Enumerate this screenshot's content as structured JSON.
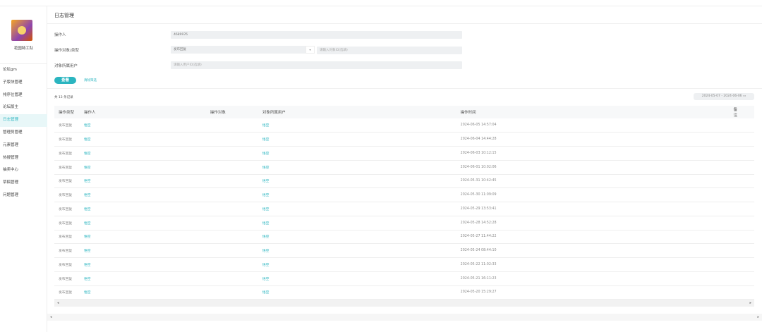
{
  "sidebar": {
    "team": "花园特工队",
    "items": [
      "论坛gm",
      "子版块管理",
      "排序位管理",
      "论坛版主",
      "日志管理",
      "管理员管理",
      "元素管理",
      "热搜管理",
      "抽奖中心",
      "草稿管理",
      "问题管理"
    ],
    "active": 4
  },
  "header": {
    "title": "日志管理"
  },
  "form": {
    "operator_label": "操作人",
    "operator_value": "4689976",
    "object_label": "操作对象/类型",
    "object_type": "发布回复",
    "object_placeholder": "请输入对象ID(选填)",
    "owner_label": "对象所属用户",
    "owner_placeholder": "请输入用户ID(选填)",
    "search_label": "查看",
    "reset_label": "清除筛选"
  },
  "count": "共 13 条记录",
  "date_range": {
    "start": "2024-05-07",
    "sep": "-",
    "end": "2024-06-06"
  },
  "table": {
    "columns": [
      "操作类型",
      "操作人",
      "操作对象",
      "对象所属用户",
      "操作时间",
      "备注"
    ],
    "rows": [
      [
        "发布回复",
        "悟空",
        "",
        "悟空",
        "2024-06-05 14:57:04",
        ""
      ],
      [
        "发布回复",
        "悟空",
        "",
        "悟空",
        "2024-06-04 14:44:28",
        ""
      ],
      [
        "发布回复",
        "悟空",
        "",
        "悟空",
        "2024-06-03 10:12:15",
        ""
      ],
      [
        "发布回复",
        "悟空",
        "",
        "悟空",
        "2024-06-01 10:02:06",
        ""
      ],
      [
        "发布回复",
        "悟空",
        "",
        "悟空",
        "2024-05-31 10:42:45",
        ""
      ],
      [
        "发布回复",
        "悟空",
        "",
        "悟空",
        "2024-05-30 11:09:09",
        ""
      ],
      [
        "发布回复",
        "悟空",
        "",
        "悟空",
        "2024-05-29 13:53:41",
        ""
      ],
      [
        "发布回复",
        "悟空",
        "",
        "悟空",
        "2024-05-28 14:52:28",
        ""
      ],
      [
        "发布回复",
        "悟空",
        "",
        "悟空",
        "2024-05-27 11:44:22",
        ""
      ],
      [
        "发布回复",
        "悟空",
        "",
        "悟空",
        "2024-05-24 08:44:10",
        ""
      ],
      [
        "发布回复",
        "悟空",
        "",
        "悟空",
        "2024-05-22 11:02:33",
        ""
      ],
      [
        "发布回复",
        "悟空",
        "",
        "悟空",
        "2024-05-21 16:11:23",
        ""
      ],
      [
        "发布回复",
        "悟空",
        "",
        "悟空",
        "2024-05-20 15:29:27",
        ""
      ]
    ]
  },
  "colors": {
    "accent": "#2bb5c0"
  }
}
